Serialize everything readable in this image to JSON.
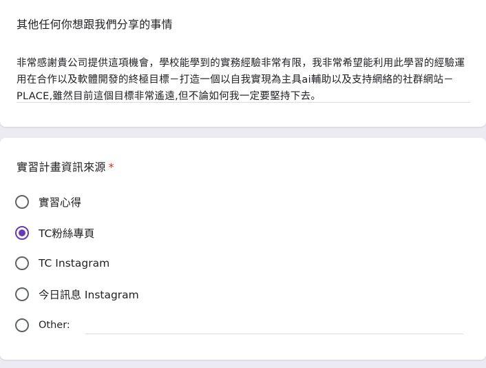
{
  "card_other": {
    "title": "其他任何你想跟我們分享的事情",
    "answer": "非常感謝貴公司提供這項機會，學校能學到的實務經驗非常有限，我非常希望能利用此學習的經驗運用在合作以及軟體開發的終極目標－打造一個以自我實現為主具ai輔助以及支持網絡的社群網站－PLACE,雖然目前這個目標非常遙遠,但不論如何我一定要堅持下去。"
  },
  "card_source": {
    "title": "實習計畫資訊來源",
    "required_mark": "*",
    "options": [
      {
        "label": "實習心得",
        "selected": false
      },
      {
        "label": "TC粉絲專頁",
        "selected": true
      },
      {
        "label": "TC Instagram",
        "selected": false
      },
      {
        "label": "今日訊息 Instagram",
        "selected": false
      },
      {
        "label": "Other:",
        "selected": false
      }
    ],
    "other_value": ""
  },
  "colors": {
    "accent": "#673ab7",
    "required": "#d93025",
    "background": "#ecebf3"
  }
}
